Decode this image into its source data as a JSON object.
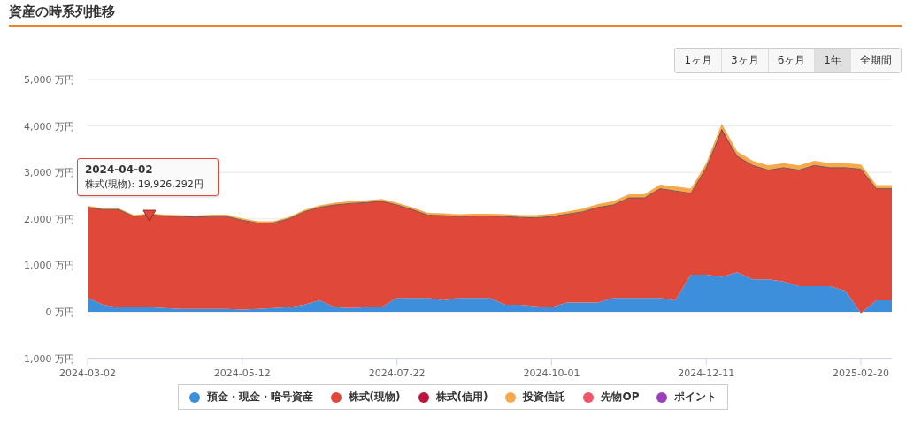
{
  "title": "資産の時系列推移",
  "ranges": [
    {
      "label": "1ヶ月",
      "selected": false
    },
    {
      "label": "3ヶ月",
      "selected": false
    },
    {
      "label": "6ヶ月",
      "selected": false
    },
    {
      "label": "1年",
      "selected": true
    },
    {
      "label": "全期間",
      "selected": false
    }
  ],
  "chart": {
    "chart_data": {
      "type": "area",
      "stacked": true,
      "categories": [
        "2024-03-02",
        null,
        null,
        null,
        null,
        null,
        null,
        null,
        null,
        null,
        "2024-05-12",
        null,
        null,
        null,
        null,
        null,
        null,
        null,
        null,
        null,
        "2024-07-22",
        null,
        null,
        null,
        null,
        null,
        null,
        null,
        null,
        null,
        "2024-10-01",
        null,
        null,
        null,
        null,
        null,
        null,
        null,
        null,
        null,
        "2024-12-11",
        null,
        null,
        null,
        null,
        null,
        null,
        null,
        null,
        null,
        "2025-02-20",
        null,
        null
      ],
      "series": [
        {
          "name": "預金・現金・暗号資産",
          "color": "#3d8edb",
          "values": [
            300,
            150,
            100,
            100,
            100,
            80,
            60,
            60,
            60,
            60,
            50,
            60,
            80,
            100,
            150,
            250,
            100,
            80,
            100,
            100,
            300,
            300,
            300,
            250,
            300,
            300,
            300,
            150,
            150,
            120,
            100,
            200,
            200,
            200,
            300,
            300,
            300,
            300,
            250,
            800,
            800,
            750,
            850,
            700,
            700,
            650,
            550,
            550,
            550,
            450,
            -30,
            250,
            250
          ]
        },
        {
          "name": "株式(現物)",
          "color": "#e0483a",
          "values": [
            1950,
            2050,
            2100,
            1950,
            1990,
            1980,
            1990,
            1980,
            1990,
            1990,
            1920,
            1850,
            1830,
            1900,
            2000,
            2000,
            2200,
            2250,
            2250,
            2280,
            2000,
            1900,
            1780,
            1820,
            1750,
            1760,
            1760,
            1900,
            1880,
            1900,
            1950,
            1900,
            1950,
            2050,
            2000,
            2150,
            2150,
            2350,
            2350,
            1750,
            2300,
            3150,
            2500,
            2450,
            2350,
            2450,
            2500,
            2600,
            2550,
            2650,
            3100,
            2400,
            2400
          ]
        },
        {
          "name": "株式(信用)",
          "color": "#c0143c",
          "values": [
            0,
            0,
            0,
            0,
            0,
            0,
            0,
            0,
            0,
            0,
            0,
            0,
            0,
            0,
            0,
            0,
            0,
            0,
            0,
            0,
            0,
            0,
            0,
            0,
            0,
            0,
            0,
            0,
            0,
            0,
            0,
            0,
            0,
            0,
            0,
            0,
            0,
            0,
            0,
            0,
            0,
            50,
            0,
            0,
            0,
            0,
            0,
            0,
            0,
            0,
            0,
            0,
            0
          ]
        },
        {
          "name": "投資信託",
          "color": "#f7a84b",
          "values": [
            30,
            30,
            30,
            30,
            30,
            30,
            30,
            30,
            40,
            40,
            40,
            40,
            40,
            40,
            40,
            40,
            50,
            50,
            50,
            50,
            50,
            50,
            50,
            50,
            50,
            50,
            50,
            50,
            50,
            60,
            60,
            60,
            70,
            70,
            80,
            80,
            80,
            90,
            100,
            100,
            100,
            100,
            100,
            100,
            100,
            100,
            100,
            100,
            100,
            100,
            100,
            80,
            80
          ]
        }
      ],
      "ylim": [
        -1000,
        5000
      ],
      "grid": true,
      "yticks": [
        {
          "value": 5000,
          "label": "5,000 万円"
        },
        {
          "value": 4000,
          "label": "4,000 万円"
        },
        {
          "value": 3000,
          "label": "3,000 万円"
        },
        {
          "value": 2000,
          "label": "2,000 万円"
        },
        {
          "value": 1000,
          "label": "1,000 万円"
        },
        {
          "value": 0,
          "label": "0 万円"
        },
        {
          "value": -1000,
          "label": "-1,000 万円"
        }
      ]
    },
    "legend_extra": [
      {
        "label": "先物OP",
        "color": "#f25468"
      },
      {
        "label": "ポイント",
        "color": "#9b3fbf"
      }
    ],
    "tooltip": {
      "date": "2024-04-02",
      "text": "株式(現物): 19,926,292円"
    }
  }
}
